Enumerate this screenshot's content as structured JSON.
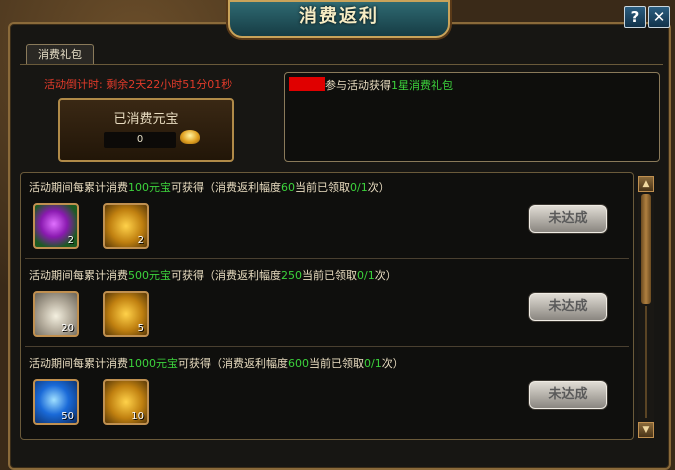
{
  "window": {
    "title": "消费返利",
    "help_label": "?",
    "close_label": "✕"
  },
  "tabs": [
    {
      "label": "消费礼包"
    }
  ],
  "countdown": {
    "label": "活动倒计时:",
    "value": "剩余2天22小时51分01秒"
  },
  "spent": {
    "label": "已消费元宝",
    "value": "0",
    "currency_icon": "gold-ingot-icon"
  },
  "message": {
    "prefix": "参与活动获得",
    "highlight": "1星消费礼包",
    "redacted_player": true
  },
  "rewards": [
    {
      "cond_prefix": "活动期间每累计消费",
      "amount": "100元宝",
      "cond_mid": "可获得（消费返利幅度",
      "rebate": "60",
      "claimed_text": "当前已领取",
      "claimed": "0/1",
      "cond_suffix": "次）",
      "items": [
        {
          "icon": "purple-gem-icon",
          "count": "2"
        },
        {
          "icon": "gold-bag-icon",
          "count": "2"
        }
      ],
      "button": "未达成"
    },
    {
      "cond_prefix": "活动期间每累计消费",
      "amount": "500元宝",
      "cond_mid": "可获得（消费返利幅度",
      "rebate": "250",
      "claimed_text": "当前已领取",
      "claimed": "0/1",
      "cond_suffix": "次）",
      "items": [
        {
          "icon": "pearls-icon",
          "count": "20"
        },
        {
          "icon": "gold-bag-icon",
          "count": "5"
        }
      ],
      "button": "未达成"
    },
    {
      "cond_prefix": "活动期间每累计消费",
      "amount": "1000元宝",
      "cond_mid": "可获得（消费返利幅度",
      "rebate": "600",
      "claimed_text": "当前已领取",
      "claimed": "0/1",
      "cond_suffix": "次）",
      "items": [
        {
          "icon": "blue-gem-icon",
          "count": "50"
        },
        {
          "icon": "gold-bag-icon",
          "count": "10"
        }
      ],
      "button": "未达成"
    }
  ],
  "colors": {
    "highlight_green": "#3cd23c",
    "countdown_red": "#e03a2a",
    "frame_gold": "#c09050"
  }
}
